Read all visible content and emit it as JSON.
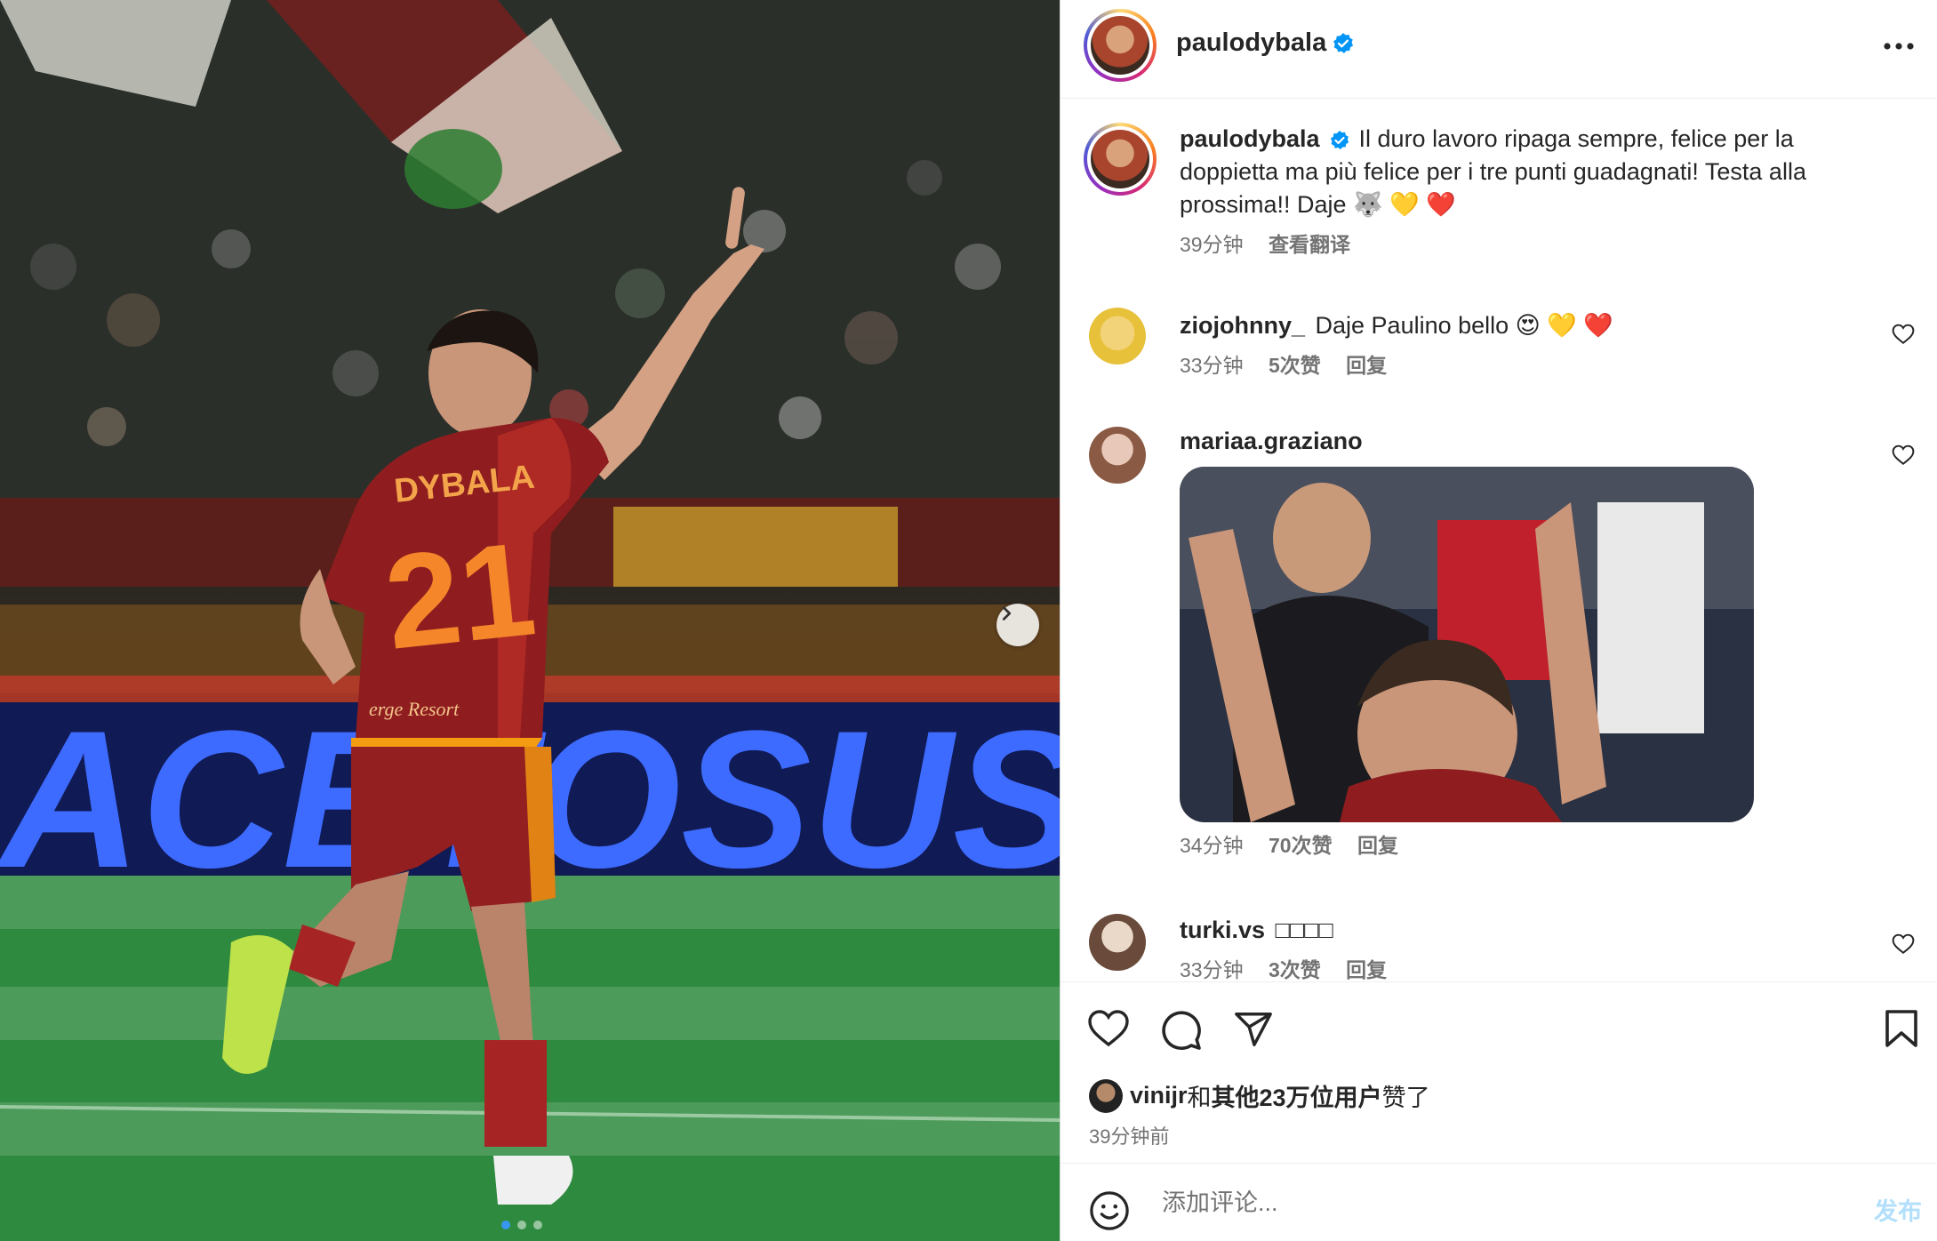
{
  "post": {
    "username": "paulodybala",
    "caption": "Il duro lavoro ripaga sempre, felice per la doppietta ma più felice per i tre punti guadagnati! Testa alla prossima!! Daje 🐺 💛 ❤️",
    "caption_time": "39分钟",
    "translate_label": "查看翻译",
    "jersey_name": "DYBALA",
    "jersey_number": "21",
    "sponsor_text": "erge Resort",
    "board_text": "ACETOSUS",
    "carousel_dots": 3,
    "active_dot": 0
  },
  "comments": [
    {
      "username": "ziojohnny_",
      "text": "Daje Paulino bello 😍 💛 ❤️",
      "time": "33分钟",
      "likes": "5次赞",
      "reply": "回复"
    },
    {
      "username": "mariaa.graziano",
      "text": "",
      "has_gif": true,
      "time": "34分钟",
      "likes": "70次赞",
      "reply": "回复"
    },
    {
      "username": "turki.vs",
      "text": "□□□□",
      "time": "33分钟",
      "likes": "3次赞",
      "reply": "回复"
    }
  ],
  "likes": {
    "liker": "vinijr",
    "connector": "和",
    "others": "其他23万位用户",
    "suffix": "赞了",
    "time_ago": "39分钟前"
  },
  "add_comment": {
    "placeholder": "添加评论...",
    "post_label": "发布"
  },
  "colors": {
    "link_blue": "#3897f0",
    "verified_blue": "#0095f6",
    "muted": "#737373",
    "post_disabled": "#b2dffc"
  },
  "icons": [
    "verified-icon",
    "more-icon",
    "heart-icon",
    "comment-icon",
    "share-icon",
    "bookmark-icon",
    "emoji-icon",
    "chevron-right-icon"
  ]
}
